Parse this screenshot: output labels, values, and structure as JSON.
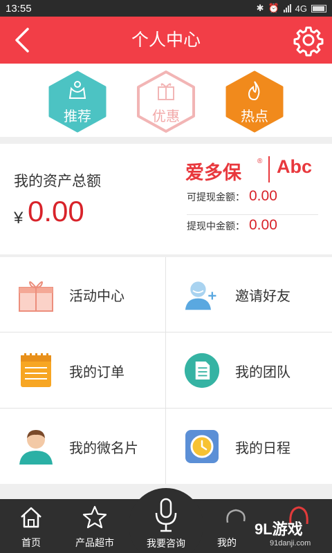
{
  "status": {
    "time": "13:55",
    "network": "4G"
  },
  "header": {
    "title": "个人中心"
  },
  "shortcuts": [
    {
      "label": "推荐",
      "color": "#4cc3c3",
      "icon": "crown-icon"
    },
    {
      "label": "优惠",
      "color": "#f4c7c7",
      "icon": "gift-icon"
    },
    {
      "label": "热点",
      "color": "#f18a1c",
      "icon": "flame-icon"
    }
  ],
  "assets": {
    "label": "我的资产总额",
    "currency": "¥",
    "amount": "0.00",
    "brand": "爱多保",
    "brand_logo": "Abc",
    "withdrawable_label": "可提现金额：",
    "withdrawable": "0.00",
    "withdrawing_label": "提现中金额：",
    "withdrawing": "0.00"
  },
  "menu": [
    {
      "label": "活动中心",
      "icon": "gift-box-icon"
    },
    {
      "label": "邀请好友",
      "icon": "add-friend-icon"
    },
    {
      "label": "我的订单",
      "icon": "order-list-icon"
    },
    {
      "label": "我的团队",
      "icon": "team-document-icon"
    },
    {
      "label": "我的微名片",
      "icon": "business-card-icon"
    },
    {
      "label": "我的日程",
      "icon": "clock-icon"
    }
  ],
  "tabbar": [
    {
      "label": "首页",
      "icon": "home-icon"
    },
    {
      "label": "产品超市",
      "icon": "star-icon"
    },
    {
      "label": "我要咨询",
      "icon": "microphone-icon"
    },
    {
      "label": "我的",
      "icon": "chat-icon"
    }
  ],
  "watermark": {
    "text": "9L游戏",
    "url": "91danji.com"
  },
  "colors": {
    "brand_red": "#f23e47",
    "amount_red": "#d8232a",
    "tabbar_bg": "#2f2f2f"
  }
}
